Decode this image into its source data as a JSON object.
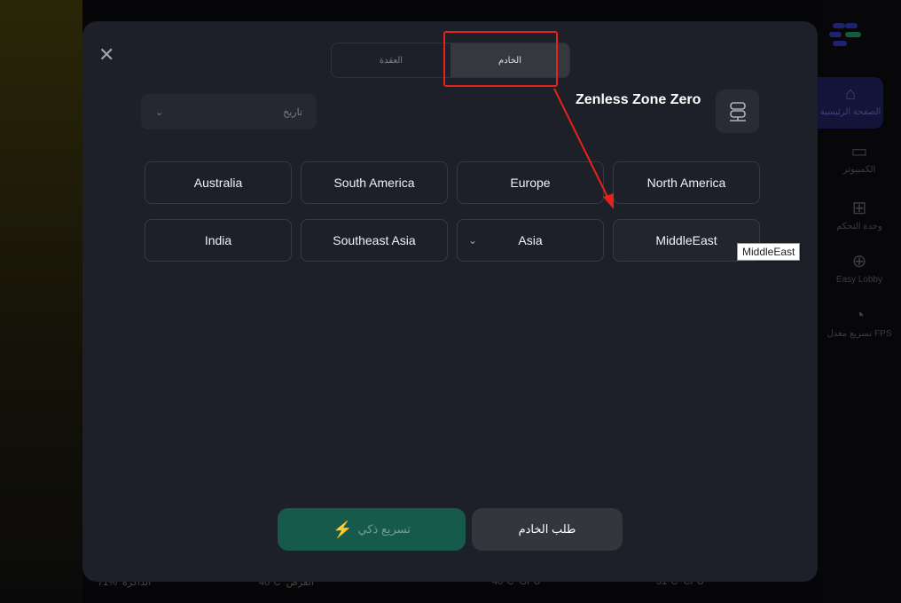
{
  "background": {
    "sidebar": {
      "items": [
        {
          "label": "الصفحة الرئيسية",
          "icon": "home-icon"
        },
        {
          "label": "الكمبيوتر",
          "icon": "monitor-icon"
        },
        {
          "label": "وحدة التحكم",
          "icon": "gamepad-icon"
        },
        {
          "label": "Easy Lobby",
          "icon": "target-icon"
        },
        {
          "label": "تسريع معدل FPS",
          "icon": "speedometer-icon"
        }
      ]
    },
    "status": [
      {
        "label": "الذاكرة",
        "value": "71%"
      },
      {
        "label": "القرص",
        "value": "40°C"
      },
      {
        "label": "GPU",
        "value": "40°C"
      },
      {
        "label": "CPU",
        "value": "51°C"
      }
    ]
  },
  "modal": {
    "tabs": [
      {
        "label": "العقدة",
        "active": false
      },
      {
        "label": "الخادم",
        "active": true
      }
    ],
    "history_select": {
      "label": "تاريخ"
    },
    "game_title": "Zenless Zone Zero",
    "regions": [
      {
        "label": "Australia"
      },
      {
        "label": "South America"
      },
      {
        "label": "Europe"
      },
      {
        "label": "North America"
      },
      {
        "label": "India"
      },
      {
        "label": "Southeast Asia"
      },
      {
        "label": "Asia",
        "has_dropdown": true
      },
      {
        "label": "MiddleEast",
        "hovered": true
      }
    ],
    "tooltip": "MiddleEast",
    "smart_boost_label": "تسريع ذكي",
    "request_server_label": "طلب الخادم"
  },
  "colors": {
    "accent_green": "#165a4c",
    "annotation_red": "#e5231b"
  }
}
